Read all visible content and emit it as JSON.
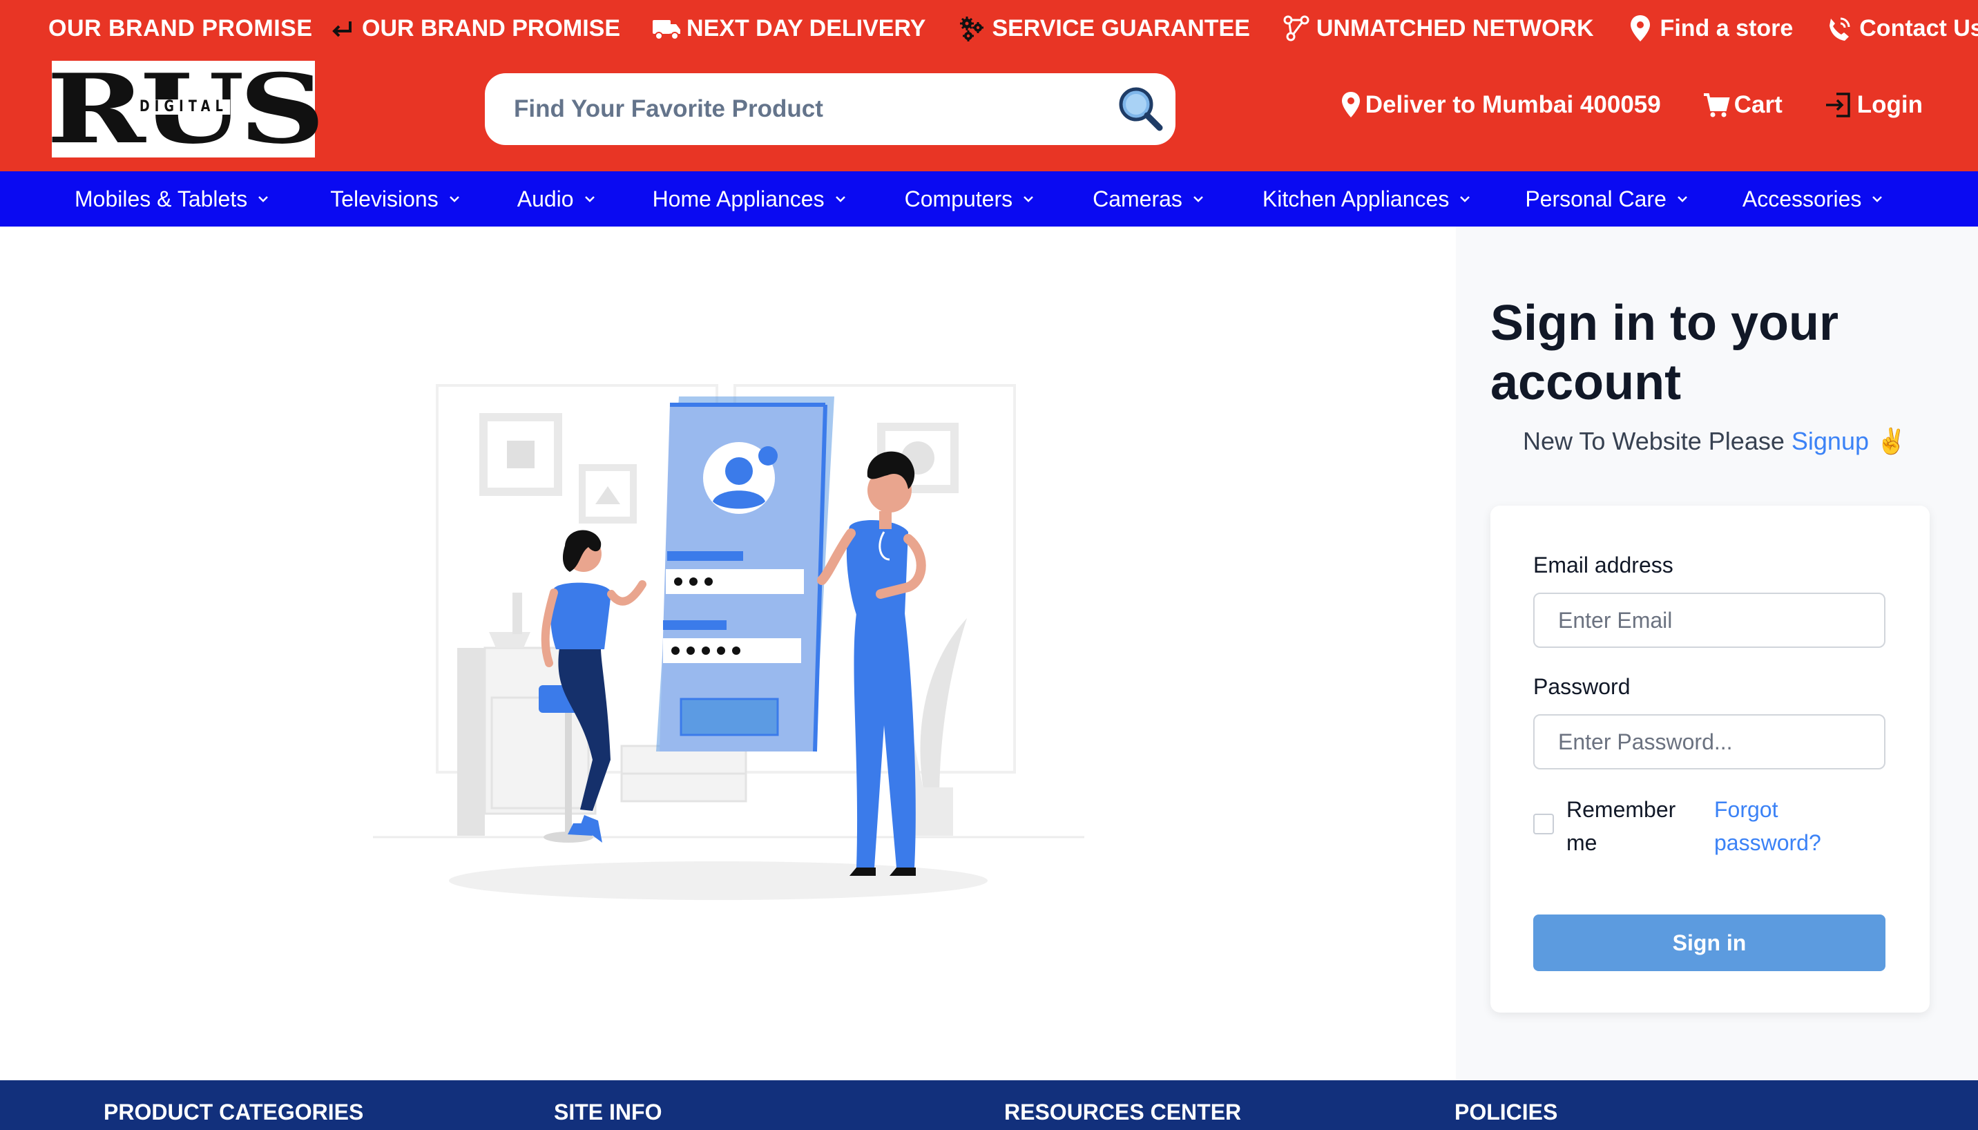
{
  "colors": {
    "header_red": "#e83525",
    "nav_blue": "#0a0af2",
    "footer_navy": "#12307c",
    "link_blue": "#3b82f6",
    "button_blue": "#5c9bdf"
  },
  "header": {
    "promise_title": "OUR BRAND PROMISE",
    "top_links": [
      {
        "icon": "return-arrow-icon",
        "label": "OUR BRAND PROMISE"
      },
      {
        "icon": "truck-icon",
        "label": "NEXT DAY DELIVERY"
      },
      {
        "icon": "gears-icon",
        "label": "SERVICE GUARANTEE"
      },
      {
        "icon": "network-icon",
        "label": "UNMATCHED NETWORK"
      },
      {
        "icon": "map-pin-icon",
        "label": "Find a store"
      },
      {
        "icon": "phone-signal-icon",
        "label": "Contact Us"
      }
    ],
    "logo": {
      "mark": "RUS",
      "sub": "DIGITAL"
    },
    "search": {
      "placeholder": "Find Your Favorite Product",
      "icon": "magnifier-icon"
    },
    "deliver_to": "Deliver to Mumbai 400059",
    "cart_label": "Cart",
    "login_label": "Login"
  },
  "nav": {
    "categories": [
      "Mobiles & Tablets",
      "Televisions",
      "Audio",
      "Home Appliances",
      "Computers",
      "Cameras",
      "Kitchen Appliances",
      "Personal Care",
      "Accessories"
    ]
  },
  "signin": {
    "title": "Sign in to your account",
    "signup_prefix": "New To Website Please",
    "signup_link": "Signup",
    "signup_emoji": "✌️",
    "email_label": "Email address",
    "email_placeholder": "Enter Email",
    "password_label": "Password",
    "password_placeholder": "Enter Password...",
    "remember_label": "Remember me",
    "forgot_label": "Forgot password?",
    "button_label": "Sign in"
  },
  "footer": {
    "headings": [
      "PRODUCT CATEGORIES",
      "SITE INFO",
      "RESOURCES CENTER",
      "POLICIES"
    ]
  }
}
